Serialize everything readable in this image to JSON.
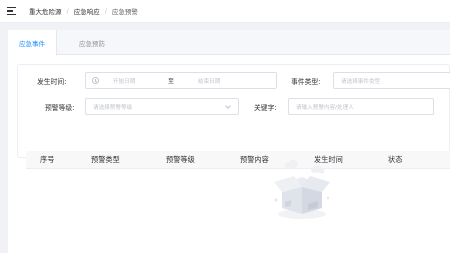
{
  "breadcrumb": {
    "items": [
      "重大危险源",
      "应急响应",
      "应急预警"
    ]
  },
  "tabs": [
    {
      "label": "应急事件",
      "active": true
    },
    {
      "label": "应急预防",
      "active": false
    }
  ],
  "filters": {
    "time_label": "发生时间:",
    "start_placeholder": "开始日期",
    "range_separator": "至",
    "end_placeholder": "结束日期",
    "event_type_label": "事件类型:",
    "event_type_placeholder": "请选择事件类型",
    "level_label": "预警等级:",
    "level_placeholder": "请选择预警等级",
    "keyword_label": "关键字:",
    "keyword_placeholder": "请输入预警内容/处理人"
  },
  "table": {
    "columns": [
      "序号",
      "预警类型",
      "预警等级",
      "预警内容",
      "发生时间",
      "状态"
    ],
    "rows": []
  },
  "colors": {
    "accent": "#1890ff",
    "border": "#dcdfe6",
    "background": "#f0f2f5"
  }
}
